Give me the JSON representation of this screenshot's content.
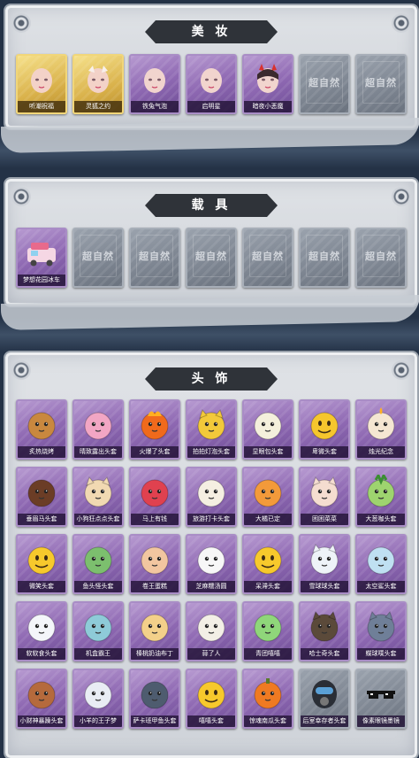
{
  "sections": {
    "makeup": {
      "title": "美 妆",
      "items": [
        {
          "label": "听潮祝福",
          "rarity": "gold",
          "icon": "doll-head-icon",
          "color": "#f3d2c8"
        },
        {
          "label": "灵狐之约",
          "rarity": "gold",
          "icon": "fox-doll-head-icon",
          "color": "#f3d2c8"
        },
        {
          "label": "铁兔气泡",
          "rarity": "purple",
          "icon": "doll-head-icon",
          "color": "#f1d4ce"
        },
        {
          "label": "启明星",
          "rarity": "purple",
          "icon": "doll-head-icon",
          "color": "#f1d4ce"
        },
        {
          "label": "暗夜小恶魔",
          "rarity": "purple",
          "icon": "devil-doll-head-icon",
          "color": "#f1d4ce"
        },
        {
          "label": "",
          "rarity": "locked",
          "icon": "locked-placeholder-icon",
          "color": "#8a929d"
        },
        {
          "label": "",
          "rarity": "locked",
          "icon": "locked-placeholder-icon",
          "color": "#8a929d"
        }
      ]
    },
    "vehicle": {
      "title": "载 具",
      "items": [
        {
          "label": "梦想花园冰车",
          "rarity": "purple",
          "icon": "ice-cream-truck-icon",
          "color": "#f5d7e4"
        },
        {
          "label": "",
          "rarity": "locked",
          "icon": "locked-placeholder-icon",
          "color": "#8a929d"
        },
        {
          "label": "",
          "rarity": "locked",
          "icon": "locked-placeholder-icon",
          "color": "#8a929d"
        },
        {
          "label": "",
          "rarity": "locked",
          "icon": "locked-placeholder-icon",
          "color": "#8a929d"
        },
        {
          "label": "",
          "rarity": "locked",
          "icon": "locked-placeholder-icon",
          "color": "#8a929d"
        },
        {
          "label": "",
          "rarity": "locked",
          "icon": "locked-placeholder-icon",
          "color": "#8a929d"
        },
        {
          "label": "",
          "rarity": "locked",
          "icon": "locked-placeholder-icon",
          "color": "#8a929d"
        }
      ]
    },
    "headwear": {
      "title": "头 饰",
      "items": [
        {
          "label": "炙热烧烤",
          "rarity": "purple",
          "icon": "grilled-meat-head-icon",
          "color": "#c9883f"
        },
        {
          "label": "晴致露出头套",
          "rarity": "purple",
          "icon": "pink-pig-head-icon",
          "color": "#f2a6c4"
        },
        {
          "label": "火爆了头套",
          "rarity": "purple",
          "icon": "fire-head-icon",
          "color": "#f06a1c"
        },
        {
          "label": "拍拍灯泡头套",
          "rarity": "purple",
          "icon": "yellow-mouse-head-icon",
          "color": "#f2c93a"
        },
        {
          "label": "显眼包头套",
          "rarity": "purple",
          "icon": "light-bulb-head-icon",
          "color": "#f4f0dc"
        },
        {
          "label": "卑微头套",
          "rarity": "purple",
          "icon": "sad-face-head-icon",
          "color": "#f6c62d"
        },
        {
          "label": "烛光纪念",
          "rarity": "purple",
          "icon": "candle-head-icon",
          "color": "#f5e6d2"
        },
        {
          "label": "垂眉马头套",
          "rarity": "purple",
          "icon": "horse-head-icon",
          "color": "#6b3d26"
        },
        {
          "label": "小狗狂点点头套",
          "rarity": "purple",
          "icon": "dog-head-icon",
          "color": "#f1d9b2"
        },
        {
          "label": "马上有钱",
          "rarity": "purple",
          "icon": "red-horse-head-icon",
          "color": "#e0414f"
        },
        {
          "label": "旅游打卡头套",
          "rarity": "purple",
          "icon": "duck-hat-head-icon",
          "color": "#f5efe2"
        },
        {
          "label": "大橘已定",
          "rarity": "purple",
          "icon": "orange-head-icon",
          "color": "#f39a3a"
        },
        {
          "label": "困困菜菜",
          "rarity": "purple",
          "icon": "cat-head-icon",
          "color": "#f5ddd0"
        },
        {
          "label": "大葱咖头套",
          "rarity": "purple",
          "icon": "green-onion-head-icon",
          "color": "#9ed46f"
        },
        {
          "label": "微笑头套",
          "rarity": "purple",
          "icon": "smile-face-head-icon",
          "color": "#f7c92c"
        },
        {
          "label": "鱼头怪头套",
          "rarity": "purple",
          "icon": "fish-head-icon",
          "color": "#7cbf6e"
        },
        {
          "label": "卷王蛋糕",
          "rarity": "purple",
          "icon": "cake-roll-head-icon",
          "color": "#f2c6a0"
        },
        {
          "label": "芝麻糯汤圆",
          "rarity": "purple",
          "icon": "dumpling-head-icon",
          "color": "#f7f7f7"
        },
        {
          "label": "呆滞头套",
          "rarity": "purple",
          "icon": "blank-face-head-icon",
          "color": "#f7c92c"
        },
        {
          "label": "雪球球头套",
          "rarity": "purple",
          "icon": "snow-cat-head-icon",
          "color": "#eef3f8"
        },
        {
          "label": "太空鲨头套",
          "rarity": "purple",
          "icon": "shark-head-icon",
          "color": "#bfe0f2"
        },
        {
          "label": "软软食头套",
          "rarity": "purple",
          "icon": "cloud-head-icon",
          "color": "#f4f6fa"
        },
        {
          "label": "机盒霸王",
          "rarity": "purple",
          "icon": "robot-dino-head-icon",
          "color": "#8ecbd8"
        },
        {
          "label": "榛桃奶油布丁",
          "rarity": "purple",
          "icon": "pudding-head-icon",
          "color": "#f3d08a"
        },
        {
          "label": "蒜了人",
          "rarity": "purple",
          "icon": "garlic-head-icon",
          "color": "#f3efe6"
        },
        {
          "label": "青团嘻嘻",
          "rarity": "purple",
          "icon": "green-ball-head-icon",
          "color": "#8fd67a"
        },
        {
          "label": "哈士奇头套",
          "rarity": "purple",
          "icon": "husky-head-icon",
          "color": "#5b4a3a"
        },
        {
          "label": "蝶球噗头套",
          "rarity": "purple",
          "icon": "grey-cat-head-icon",
          "color": "#6f7f98"
        },
        {
          "label": "小财神暴躁头套",
          "rarity": "purple",
          "icon": "capybara-head-icon",
          "color": "#b56a3c"
        },
        {
          "label": "小羊的王子梦",
          "rarity": "purple",
          "icon": "sheep-head-icon",
          "color": "#e9edf4"
        },
        {
          "label": "萨卡班甲鱼头套",
          "rarity": "purple",
          "icon": "seal-head-icon",
          "color": "#4e5c6f"
        },
        {
          "label": "嘻嘻头套",
          "rarity": "purple",
          "icon": "grin-face-head-icon",
          "color": "#f7c92c"
        },
        {
          "label": "惊魂南瓜头套",
          "rarity": "purple",
          "icon": "pumpkin-head-icon",
          "color": "#ef7a22"
        },
        {
          "label": "后室幸存者头套",
          "rarity": "locked",
          "icon": "gas-mask-head-icon",
          "color": "#2a2e36"
        },
        {
          "label": "像素眼镜墨镜",
          "rarity": "locked",
          "icon": "pixel-sunglasses-icon",
          "color": "#111111"
        }
      ]
    }
  },
  "locked_watermark": "超自然"
}
